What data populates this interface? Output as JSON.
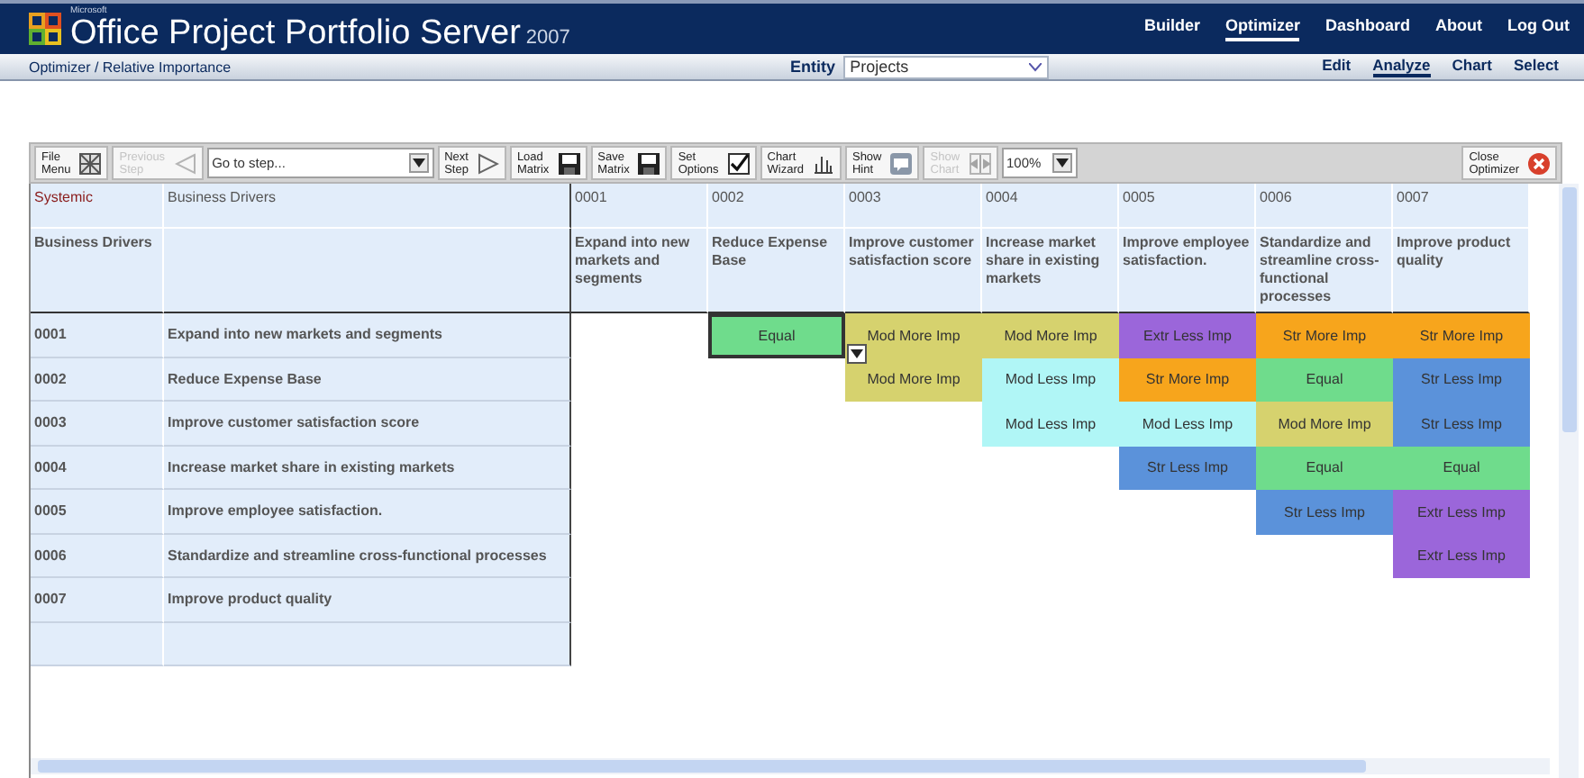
{
  "header": {
    "brand_small": "Microsoft",
    "title": "Office Project Portfolio Server",
    "version": "2007",
    "nav": [
      {
        "label": "Builder",
        "selected": false
      },
      {
        "label": "Optimizer",
        "selected": true
      },
      {
        "label": "Dashboard",
        "selected": false
      },
      {
        "label": "About",
        "selected": false
      },
      {
        "label": "Log Out",
        "selected": false
      }
    ]
  },
  "subbar": {
    "breadcrumb": "Optimizer / Relative Importance",
    "entity_label": "Entity",
    "entity_value": "Projects",
    "subnav": [
      {
        "label": "Edit",
        "selected": false
      },
      {
        "label": "Analyze",
        "selected": true
      },
      {
        "label": "Chart",
        "selected": false
      },
      {
        "label": "Select",
        "selected": false
      }
    ]
  },
  "toolbar": {
    "items": [
      {
        "kind": "button",
        "lines": [
          "File",
          "Menu"
        ],
        "disabled": false
      },
      {
        "kind": "button",
        "lines": [
          "Previous",
          "Step"
        ],
        "disabled": true
      },
      {
        "kind": "select",
        "value": "Go to step..."
      },
      {
        "kind": "button",
        "lines": [
          "Next",
          "Step"
        ],
        "disabled": false
      },
      {
        "kind": "button",
        "lines": [
          "Load",
          "Matrix"
        ],
        "disabled": false
      },
      {
        "kind": "button",
        "lines": [
          "Save",
          "Matrix"
        ],
        "disabled": false
      },
      {
        "kind": "button",
        "lines": [
          "Set",
          "Options"
        ],
        "disabled": false
      },
      {
        "kind": "button",
        "lines": [
          "Chart",
          "Wizard"
        ],
        "disabled": false
      },
      {
        "kind": "button",
        "lines": [
          "Show",
          "Hint"
        ],
        "disabled": false
      },
      {
        "kind": "button",
        "lines": [
          "Show",
          "Chart"
        ],
        "disabled": true
      },
      {
        "kind": "select",
        "value": "100%"
      }
    ],
    "close": {
      "lines": [
        "Close",
        "Optimizer"
      ]
    }
  },
  "grid": {
    "corner": [
      "Systemic",
      "Business Drivers"
    ],
    "corner_row2": "Business Drivers",
    "columns": [
      {
        "code": "0001",
        "name": "Expand into new markets and segments"
      },
      {
        "code": "0002",
        "name": "Reduce Expense Base"
      },
      {
        "code": "0003",
        "name": "Improve customer satisfaction score"
      },
      {
        "code": "0004",
        "name": "Increase market share in existing markets"
      },
      {
        "code": "0005",
        "name": "Improve employee satisfaction."
      },
      {
        "code": "0006",
        "name": "Standardize and streamline cross-functional processes"
      },
      {
        "code": "0007",
        "name": "Improve product quality"
      }
    ],
    "rows": [
      {
        "code": "0001",
        "name": "Expand into new markets and segments",
        "cells": [
          null,
          {
            "text": "Equal",
            "color": "#6fdc8c",
            "selected": true
          },
          {
            "text": "Mod More Imp",
            "color": "#d6d26e",
            "selected": false
          },
          {
            "text": "Mod More Imp",
            "color": "#d6d26e",
            "selected": false
          },
          {
            "text": "Extr Less Imp",
            "color": "#9b66da",
            "selected": false
          },
          {
            "text": "Str More Imp",
            "color": "#f7a51c",
            "selected": false
          },
          {
            "text": "Str More Imp",
            "color": "#f7a51c",
            "selected": false
          }
        ]
      },
      {
        "code": "0002",
        "name": "Reduce Expense Base",
        "cells": [
          null,
          null,
          {
            "text": "Mod More Imp",
            "color": "#d6d26e",
            "selected": false
          },
          {
            "text": "Mod Less Imp",
            "color": "#b0f6f6",
            "selected": false
          },
          {
            "text": "Str More Imp",
            "color": "#f7a51c",
            "selected": false
          },
          {
            "text": "Equal",
            "color": "#6fdc8c",
            "selected": false
          },
          {
            "text": "Str Less Imp",
            "color": "#5b92da",
            "selected": false
          }
        ]
      },
      {
        "code": "0003",
        "name": "Improve customer satisfaction score",
        "cells": [
          null,
          null,
          null,
          {
            "text": "Mod Less Imp",
            "color": "#b0f6f6",
            "selected": false
          },
          {
            "text": "Mod Less Imp",
            "color": "#b0f6f6",
            "selected": false
          },
          {
            "text": "Mod More Imp",
            "color": "#d6d26e",
            "selected": false
          },
          {
            "text": "Str Less Imp",
            "color": "#5b92da",
            "selected": false
          }
        ]
      },
      {
        "code": "0004",
        "name": "Increase market share in existing markets",
        "cells": [
          null,
          null,
          null,
          null,
          {
            "text": "Str Less Imp",
            "color": "#5b92da",
            "selected": false
          },
          {
            "text": "Equal",
            "color": "#6fdc8c",
            "selected": false
          },
          {
            "text": "Equal",
            "color": "#6fdc8c",
            "selected": false
          }
        ]
      },
      {
        "code": "0005",
        "name": "Improve employee satisfaction.",
        "cells": [
          null,
          null,
          null,
          null,
          null,
          {
            "text": "Str Less Imp",
            "color": "#5b92da",
            "selected": false
          },
          {
            "text": "Extr Less Imp",
            "color": "#9b66da",
            "selected": false
          }
        ]
      },
      {
        "code": "0006",
        "name": "Standardize and streamline cross-functional processes",
        "cells": [
          null,
          null,
          null,
          null,
          null,
          null,
          {
            "text": "Extr Less Imp",
            "color": "#9b66da",
            "selected": false
          }
        ]
      },
      {
        "code": "0007",
        "name": "Improve product quality",
        "cells": [
          null,
          null,
          null,
          null,
          null,
          null,
          null
        ]
      }
    ]
  }
}
